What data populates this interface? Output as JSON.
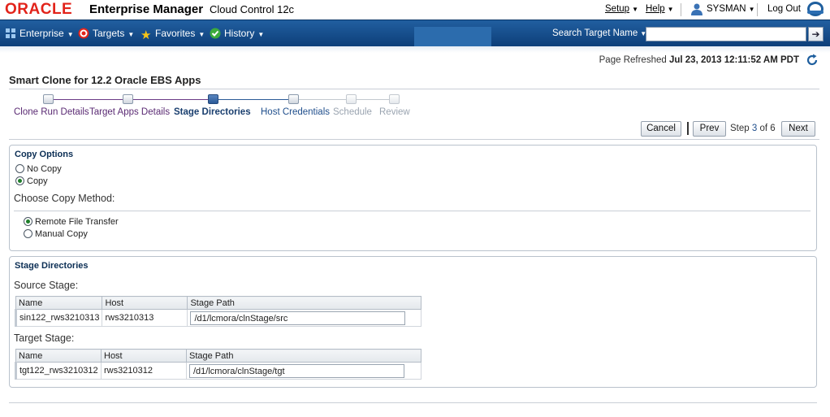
{
  "header": {
    "logo": "ORACLE",
    "product": "Enterprise Manager",
    "subproduct": "Cloud Control 12c",
    "setup": "Setup",
    "help": "Help",
    "user": "SYSMAN",
    "logout": "Log Out"
  },
  "nav": {
    "enterprise": "Enterprise",
    "targets": "Targets",
    "favorites": "Favorites",
    "history": "History",
    "search_label": "Search Target Name",
    "search_value": ""
  },
  "refresh": {
    "label": "Page Refreshed",
    "value": "Jul 23, 2013 12:11:52 AM PDT"
  },
  "page_title": "Smart Clone for 12.2 Oracle EBS Apps",
  "train": {
    "steps": [
      {
        "label": "Clone Run Details",
        "state": "visited"
      },
      {
        "label": "Target Apps Details",
        "state": "visited"
      },
      {
        "label": "Stage Directories",
        "state": "current"
      },
      {
        "label": "Host Credentials",
        "state": "next"
      },
      {
        "label": "Schedule",
        "state": "disabled"
      },
      {
        "label": "Review",
        "state": "disabled"
      }
    ]
  },
  "buttons": {
    "cancel": "Cancel",
    "prev": "Prev",
    "step_prefix": "Step",
    "step_current": "3",
    "step_suffix": "of 6",
    "next": "Next"
  },
  "copy_options": {
    "title": "Copy Options",
    "no_copy": "No Copy",
    "copy": "Copy",
    "selected": "copy",
    "method_title": "Choose Copy Method:",
    "remote": "Remote File Transfer",
    "manual": "Manual Copy",
    "method_selected": "remote"
  },
  "stage_directories": {
    "title": "Stage Directories",
    "columns": [
      "Name",
      "Host",
      "Stage Path"
    ],
    "source": {
      "title": "Source Stage:",
      "name": "sin122_rws3210313",
      "host": "rws3210313",
      "path": "/d1/lcmora/clnStage/src"
    },
    "target": {
      "title": "Target Stage:",
      "name": "tgt122_rws3210312",
      "host": "rws3210312",
      "path": "/d1/lcmora/clnStage/tgt"
    }
  },
  "colors": {
    "brand_red": "#e2231a",
    "nav_blue": "#1b5394",
    "current_step": "#2b5a97",
    "radio_on": "#1e7e2a"
  }
}
